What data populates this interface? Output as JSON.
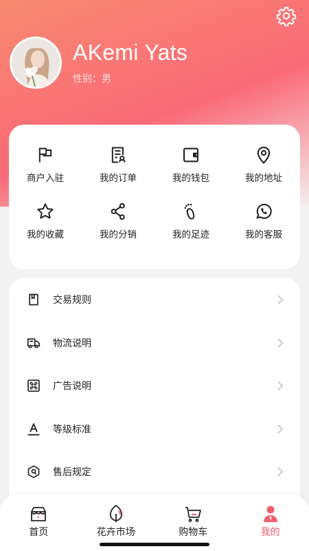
{
  "profile": {
    "name": "AKemi Yats",
    "gender": "性别：男"
  },
  "colors": {
    "accent": "#f25e6c",
    "hero_top": "#f78a70",
    "hero_mid": "#fa6a78"
  },
  "grid": [
    {
      "label": "商户入驻",
      "icon": "flag-icon"
    },
    {
      "label": "我的订单",
      "icon": "order-icon"
    },
    {
      "label": "我的钱包",
      "icon": "wallet-icon"
    },
    {
      "label": "我的地址",
      "icon": "location-pin-icon"
    },
    {
      "label": "我的收藏",
      "icon": "star-icon"
    },
    {
      "label": "我的分销",
      "icon": "share-icon"
    },
    {
      "label": "我的足迹",
      "icon": "footprint-icon"
    },
    {
      "label": "我的客服",
      "icon": "whatsapp-icon"
    }
  ],
  "menu": [
    {
      "label": "交易规则",
      "icon": "bookmark-icon"
    },
    {
      "label": "物流说明",
      "icon": "truck-icon"
    },
    {
      "label": "广告说明",
      "icon": "command-icon"
    },
    {
      "label": "等级标准",
      "icon": "text-a-icon"
    },
    {
      "label": "售后规定",
      "icon": "shield-icon"
    }
  ],
  "tabs": [
    {
      "label": "首页",
      "icon": "home-icon"
    },
    {
      "label": "花卉市场",
      "icon": "leaf-icon"
    },
    {
      "label": "购物车",
      "icon": "cart-icon"
    },
    {
      "label": "我的",
      "icon": "user-icon"
    }
  ]
}
